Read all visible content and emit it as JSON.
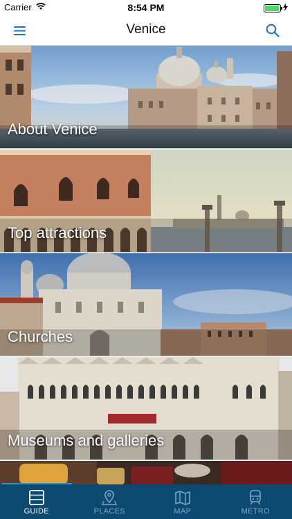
{
  "status_bar": {
    "carrier": "Carrier",
    "time": "8:54 PM",
    "battery_level": 0.95,
    "battery_color": "#4cd964"
  },
  "nav": {
    "title": "Venice",
    "menu_icon": "hamburger-menu-icon",
    "search_icon": "search-icon",
    "accent": "#1a73c7"
  },
  "categories": [
    {
      "label": "About Venice"
    },
    {
      "label": "Top attractions"
    },
    {
      "label": "Churches"
    },
    {
      "label": "Museums and galleries"
    }
  ],
  "tabs": [
    {
      "label": "GUIDE",
      "icon": "guide-list-icon",
      "active": true
    },
    {
      "label": "PLACES",
      "icon": "map-pin-icon",
      "active": false
    },
    {
      "label": "MAP",
      "icon": "folded-map-icon",
      "active": false
    },
    {
      "label": "METRO",
      "icon": "train-icon",
      "active": false
    }
  ]
}
